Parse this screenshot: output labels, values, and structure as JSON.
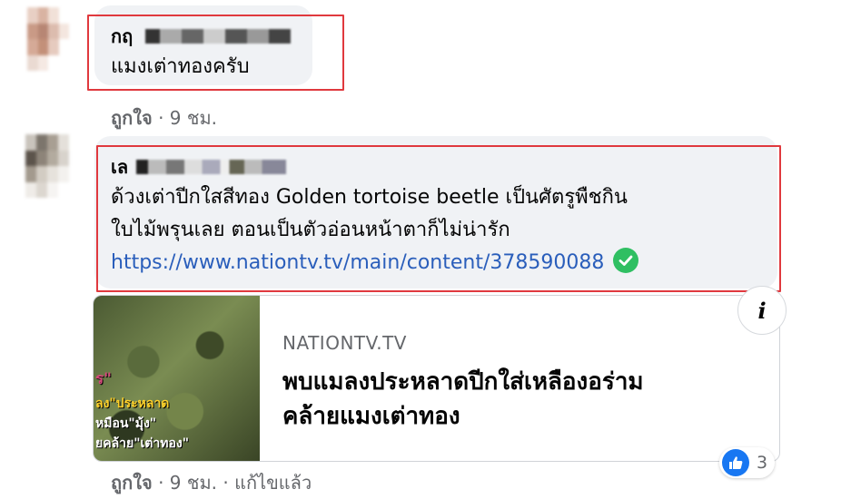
{
  "comment1": {
    "author": "กฤ",
    "text": "แมงเต่าทองครับ",
    "actions": {
      "like": "ถูกใจ",
      "sep": "·",
      "time": "9 ชม."
    }
  },
  "comment2": {
    "author": "เล",
    "text_line1": "ด้วงเต่าปีกใสสีทอง Golden tortoise beetle เป็นศัตรูพืชกิน",
    "text_line2": "ใบไม้พรุนเลย ตอนเป็นตัวอ่อนหน้าตาก็ไม่น่ารัก",
    "link": "https://www.nationtv.tv/main/content/378590088",
    "link_icon": "verified-check-icon",
    "preview": {
      "domain": "NATIONTV.TV",
      "title_line1": "พบแมลงประหลาดปีกใส่เหลืองอร่าม",
      "title_line2": "คล้ายแมงเต่าทอง",
      "thumb_caption1": "ร\"",
      "thumb_caption2": "ลง\"ประหลาด",
      "thumb_caption3": "หมือน\"มุ้ง\"",
      "thumb_caption4": "ยคล้าย\"เต่าทอง\""
    },
    "info_icon": "info-icon",
    "reaction_count": "3",
    "actions": {
      "like": "ถูกใจ",
      "sep": "·",
      "time": "9 ชม.",
      "sep2": "·",
      "edited": "แก้ไขแล้ว"
    }
  },
  "colors": {
    "highlight": "#e0393e",
    "link": "#2a5ebb",
    "bubble": "#f0f2f5",
    "like": "#1877f2"
  }
}
